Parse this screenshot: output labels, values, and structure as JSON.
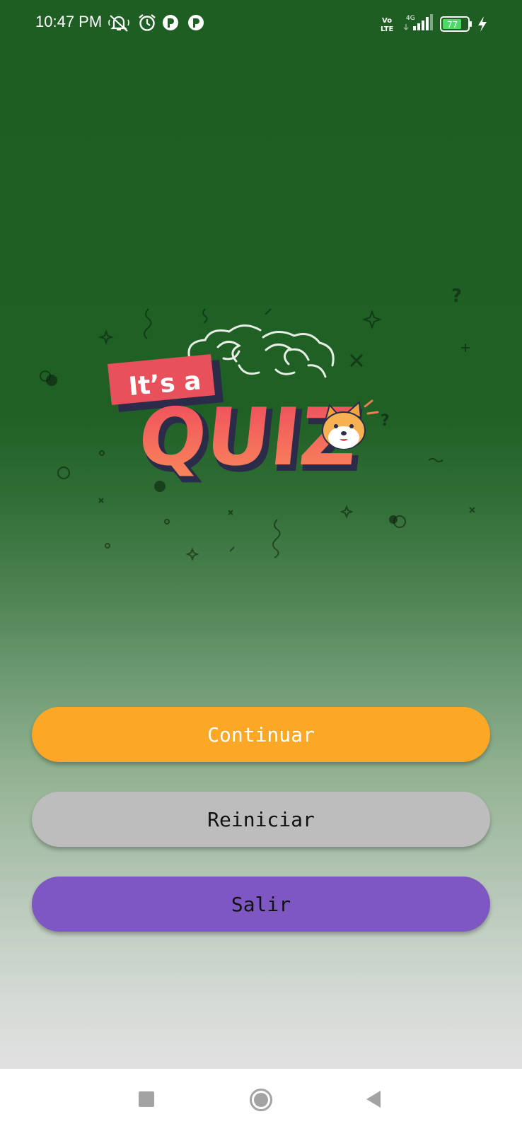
{
  "status_bar": {
    "time": "10:47 PM",
    "volte_label_top": "Vo",
    "volte_label_bottom": "LTE",
    "network": "4G",
    "battery_level": "77",
    "icons": [
      "mute-icon",
      "alarm-icon",
      "app-notification-icon",
      "app-notification-icon",
      "volte-icon",
      "signal-icon",
      "battery-icon",
      "charging-icon"
    ]
  },
  "logo": {
    "line1": "It’s a",
    "line2": "QUIZ",
    "question_mark": "?",
    "colors": {
      "banner": "#e8505b",
      "quiz_gradient_top": "#ef4a5e",
      "quiz_gradient_bottom": "#f98a5a",
      "outline": "#2b2c4a"
    }
  },
  "buttons": {
    "continue": "Continuar",
    "restart": "Reiniciar",
    "exit": "Salir"
  },
  "colors": {
    "continue_button": "#fca826",
    "restart_button": "#bdbdbd",
    "exit_button": "#7e57c2",
    "background_top": "#1e5e22",
    "background_bottom": "#e1e1e1"
  },
  "nav_bar": {
    "icons": [
      "recents-square-icon",
      "home-circle-icon",
      "back-triangle-icon"
    ]
  }
}
